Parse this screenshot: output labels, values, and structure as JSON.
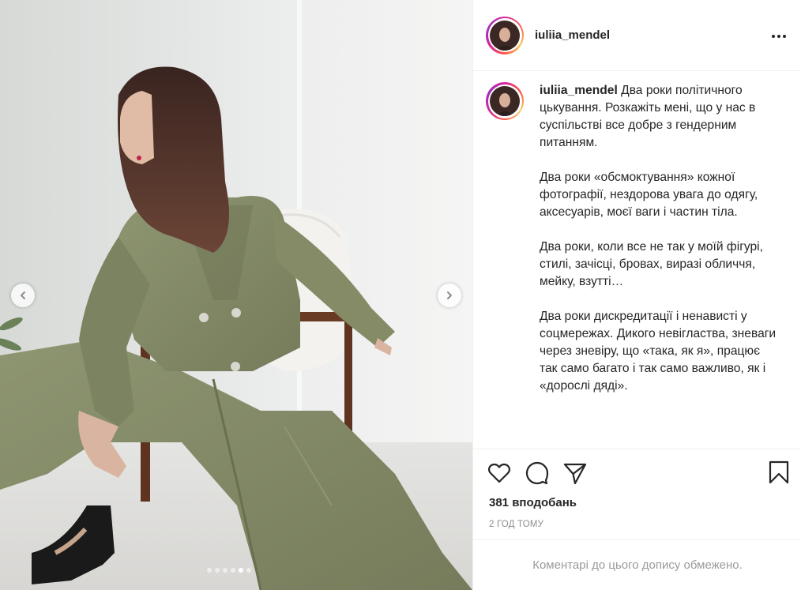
{
  "post": {
    "username": "iuliia_mendel",
    "caption_paragraphs": [
      "Два роки політичного цькування. Розкажіть мені, що у нас в суспільстві все добре з гендерним питанням.",
      "Два роки «обсмоктування» кожної фотографії, нездорова увага до одягу, аксесуарів, моєї ваги і частин тіла.",
      "Два роки, коли все не так у моїй фігурі, стилі, зачісці, бровах, виразі обличчя, мейку, взутті…",
      "Два роки дискредитації і ненависті у соцмережах. Дикого невігластва, зневаги через зневіру, що «така, як я», працює так само багато і так само важливо, як і «дорослі дяді»."
    ],
    "likes": "381 вподобань",
    "time_ago": "2 ГОД ТОМУ",
    "comments_notice": "Коментарі до цього допису обмежено."
  },
  "carousel": {
    "slide_count": 6,
    "active_slide": 5
  },
  "icons": {
    "more": "more-options-icon",
    "like": "heart-icon",
    "comment": "comment-icon",
    "share": "paper-plane-icon",
    "save": "bookmark-icon",
    "prev": "chevron-left-icon",
    "next": "chevron-right-icon"
  },
  "colors": {
    "text": "#262626",
    "muted": "#8e8e8e",
    "border": "#efefef",
    "story_ring": "#d6249f"
  }
}
